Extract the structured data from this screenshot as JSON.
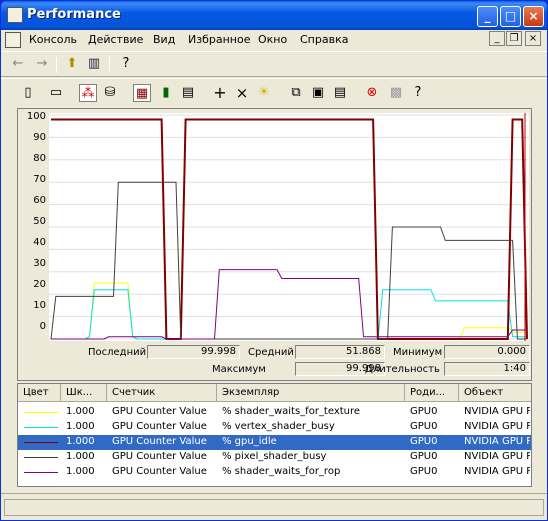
{
  "window": {
    "title": "Performance"
  },
  "menu": {
    "items": [
      "Консоль",
      "Действие",
      "Вид",
      "Избранное",
      "Окно",
      "Справка"
    ]
  },
  "toolbar1": {
    "icons": [
      "back-arrow-icon",
      "forward-arrow-icon",
      "up-folder-icon",
      "show-hide-tree-icon",
      "help-icon"
    ]
  },
  "toolbar2": {
    "icons": [
      "new-counter-set-icon",
      "clear-display-icon",
      "view-current-activity-icon",
      "view-log-data-icon",
      "view-graph-icon",
      "view-histogram-icon",
      "view-report-icon",
      "add-icon",
      "delete-icon",
      "highlight-icon",
      "copy-properties-icon",
      "paste-counter-list-icon",
      "properties-icon",
      "freeze-display-icon",
      "update-data-icon",
      "help-icon"
    ]
  },
  "stats": {
    "last_label": "Последний",
    "last_value": "99.998",
    "avg_label": "Средний",
    "avg_value": "51.868",
    "min_label": "Минимум",
    "min_value": "0.000",
    "max_label": "Максимум",
    "max_value": "99.998",
    "duration_label": "Длительность",
    "duration_value": "1:40"
  },
  "legend": {
    "headers": [
      "Цвет",
      "Шк...",
      "Счетчик",
      "Экземпляр",
      "Роди...",
      "Объект"
    ],
    "rows": [
      {
        "color": "#ffff00",
        "scale": "1.000",
        "counter": "GPU Counter Value",
        "instance": "% shader_waits_for_texture",
        "parent": "GPU0",
        "object": "NVIDIA GPU P..."
      },
      {
        "color": "#00e0e0",
        "scale": "1.000",
        "counter": "GPU Counter Value",
        "instance": "% vertex_shader_busy",
        "parent": "GPU0",
        "object": "NVIDIA GPU P..."
      },
      {
        "color": "#800000",
        "scale": "1.000",
        "counter": "GPU Counter Value",
        "instance": "% gpu_idle",
        "parent": "GPU0",
        "object": "NVIDIA GPU P...",
        "selected": true
      },
      {
        "color": "#404040",
        "scale": "1.000",
        "counter": "GPU Counter Value",
        "instance": "% pixel_shader_busy",
        "parent": "GPU0",
        "object": "NVIDIA GPU P..."
      },
      {
        "color": "#800080",
        "scale": "1.000",
        "counter": "GPU Counter Value",
        "instance": "% shader_waits_for_rop",
        "parent": "GPU0",
        "object": "NVIDIA GPU P..."
      }
    ]
  },
  "chart_data": {
    "type": "line",
    "ylim": [
      0,
      100
    ],
    "yticks": [
      "100",
      "90",
      "80",
      "70",
      "60",
      "50",
      "40",
      "30",
      "20",
      "10",
      "0"
    ],
    "grid": true,
    "x": [
      1,
      2,
      3,
      4,
      5,
      6,
      7,
      8,
      9,
      10,
      11,
      12,
      13,
      14,
      15,
      16,
      17,
      18,
      19,
      20,
      21,
      22,
      23,
      24,
      25,
      26,
      27,
      28,
      29,
      30,
      31,
      32,
      33,
      34,
      35,
      36,
      37,
      38,
      39,
      40,
      41,
      42,
      43,
      44,
      45,
      46,
      47,
      48,
      49,
      50,
      51,
      52,
      53,
      54,
      55,
      56,
      57,
      58,
      59,
      60,
      61,
      62,
      63,
      64,
      65,
      66,
      67,
      68,
      69,
      70,
      71,
      72,
      73,
      74,
      75,
      76,
      77,
      78,
      79,
      80,
      81,
      82,
      83,
      84,
      85,
      86,
      87,
      88,
      89,
      90,
      91,
      92,
      93,
      94,
      95,
      96,
      97,
      98,
      99,
      100
    ],
    "series": [
      {
        "name": "% shader_waits_for_texture",
        "color": "#ffff00",
        "values": [
          0,
          0,
          0,
          0,
          0,
          0,
          0,
          0,
          1,
          25,
          25,
          25,
          25,
          25,
          25,
          25,
          25,
          1,
          0,
          0,
          0,
          0,
          0,
          0,
          0,
          0,
          0,
          0,
          0,
          0,
          0,
          0,
          0,
          0,
          0,
          0,
          0,
          0,
          0,
          0,
          0,
          0,
          0,
          0,
          0,
          0,
          0,
          0,
          0,
          0,
          0,
          0,
          0,
          0,
          0,
          0,
          0,
          0,
          0,
          0,
          0,
          0,
          0,
          0,
          0,
          0,
          0,
          0,
          0,
          0,
          0,
          0,
          0,
          0,
          0,
          0,
          0,
          0,
          0,
          0,
          0,
          0,
          0,
          0,
          0,
          0,
          5,
          5,
          5,
          5,
          5,
          5,
          5,
          5,
          5,
          5,
          3,
          3,
          3,
          3
        ]
      },
      {
        "name": "% vertex_shader_busy",
        "color": "#00e0e0",
        "values": [
          0,
          0,
          0,
          0,
          0,
          0,
          0,
          0,
          1,
          22,
          22,
          22,
          22,
          22,
          22,
          22,
          22,
          1,
          0,
          0,
          0,
          0,
          0,
          0,
          0,
          0,
          0,
          0,
          0,
          0,
          0,
          0,
          0,
          0,
          0,
          0,
          0,
          0,
          0,
          0,
          0,
          0,
          0,
          0,
          0,
          0,
          0,
          0,
          0,
          0,
          0,
          0,
          0,
          0,
          0,
          0,
          0,
          0,
          0,
          0,
          0,
          0,
          0,
          0,
          0,
          0,
          0,
          0,
          0,
          22,
          22,
          22,
          22,
          22,
          22,
          22,
          22,
          22,
          22,
          22,
          17,
          17,
          17,
          17,
          17,
          17,
          17,
          17,
          17,
          17,
          17,
          17,
          17,
          17,
          17,
          17,
          1,
          1,
          1,
          1
        ]
      },
      {
        "name": "% gpu_idle",
        "color": "#800000",
        "values": [
          98,
          98,
          98,
          98,
          98,
          98,
          98,
          98,
          98,
          98,
          98,
          98,
          98,
          98,
          98,
          98,
          98,
          98,
          98,
          98,
          98,
          98,
          98,
          98,
          0,
          0,
          0,
          0,
          98,
          98,
          98,
          98,
          98,
          98,
          98,
          98,
          98,
          98,
          98,
          98,
          98,
          98,
          98,
          98,
          98,
          98,
          98,
          98,
          98,
          98,
          98,
          98,
          98,
          98,
          98,
          98,
          98,
          98,
          98,
          98,
          98,
          98,
          98,
          98,
          98,
          98,
          98,
          98,
          0,
          0,
          0,
          0,
          0,
          0,
          0,
          0,
          0,
          0,
          0,
          0,
          0,
          0,
          0,
          0,
          0,
          0,
          0,
          0,
          0,
          0,
          0,
          0,
          0,
          0,
          0,
          0,
          98,
          98,
          98,
          0
        ]
      },
      {
        "name": "% pixel_shader_busy",
        "color": "#404040",
        "values": [
          0,
          19,
          19,
          19,
          19,
          19,
          19,
          19,
          19,
          19,
          19,
          19,
          19,
          19,
          70,
          70,
          70,
          70,
          70,
          70,
          70,
          70,
          70,
          70,
          70,
          70,
          70,
          0,
          0,
          0,
          0,
          0,
          0,
          0,
          0,
          0,
          0,
          0,
          0,
          0,
          0,
          0,
          0,
          0,
          0,
          0,
          0,
          0,
          0,
          0,
          0,
          0,
          0,
          0,
          0,
          0,
          0,
          0,
          0,
          0,
          0,
          0,
          0,
          0,
          0,
          0,
          0,
          0,
          0,
          0,
          0,
          50,
          50,
          50,
          50,
          50,
          50,
          50,
          50,
          50,
          50,
          50,
          44,
          44,
          44,
          44,
          44,
          44,
          44,
          44,
          44,
          44,
          44,
          44,
          44,
          44,
          44,
          0,
          0,
          0
        ]
      },
      {
        "name": "% shader_waits_for_rop",
        "color": "#800080",
        "values": [
          0,
          0,
          0,
          0,
          0,
          0,
          0,
          0,
          0,
          0,
          0,
          0,
          1,
          1,
          1,
          1,
          1,
          1,
          1,
          1,
          1,
          1,
          1,
          1,
          0,
          0,
          0,
          0,
          0,
          0,
          0,
          0,
          0,
          0,
          0,
          31,
          31,
          31,
          31,
          31,
          31,
          31,
          31,
          31,
          31,
          31,
          31,
          31,
          27,
          27,
          27,
          27,
          27,
          27,
          27,
          27,
          27,
          27,
          27,
          27,
          27,
          27,
          27,
          27,
          27,
          1,
          1,
          1,
          1,
          1,
          1,
          1,
          1,
          1,
          1,
          1,
          1,
          1,
          1,
          1,
          1,
          1,
          1,
          1,
          1,
          1,
          1,
          1,
          1,
          1,
          1,
          1,
          1,
          1,
          1,
          1,
          4,
          4,
          4,
          4
        ]
      }
    ]
  }
}
